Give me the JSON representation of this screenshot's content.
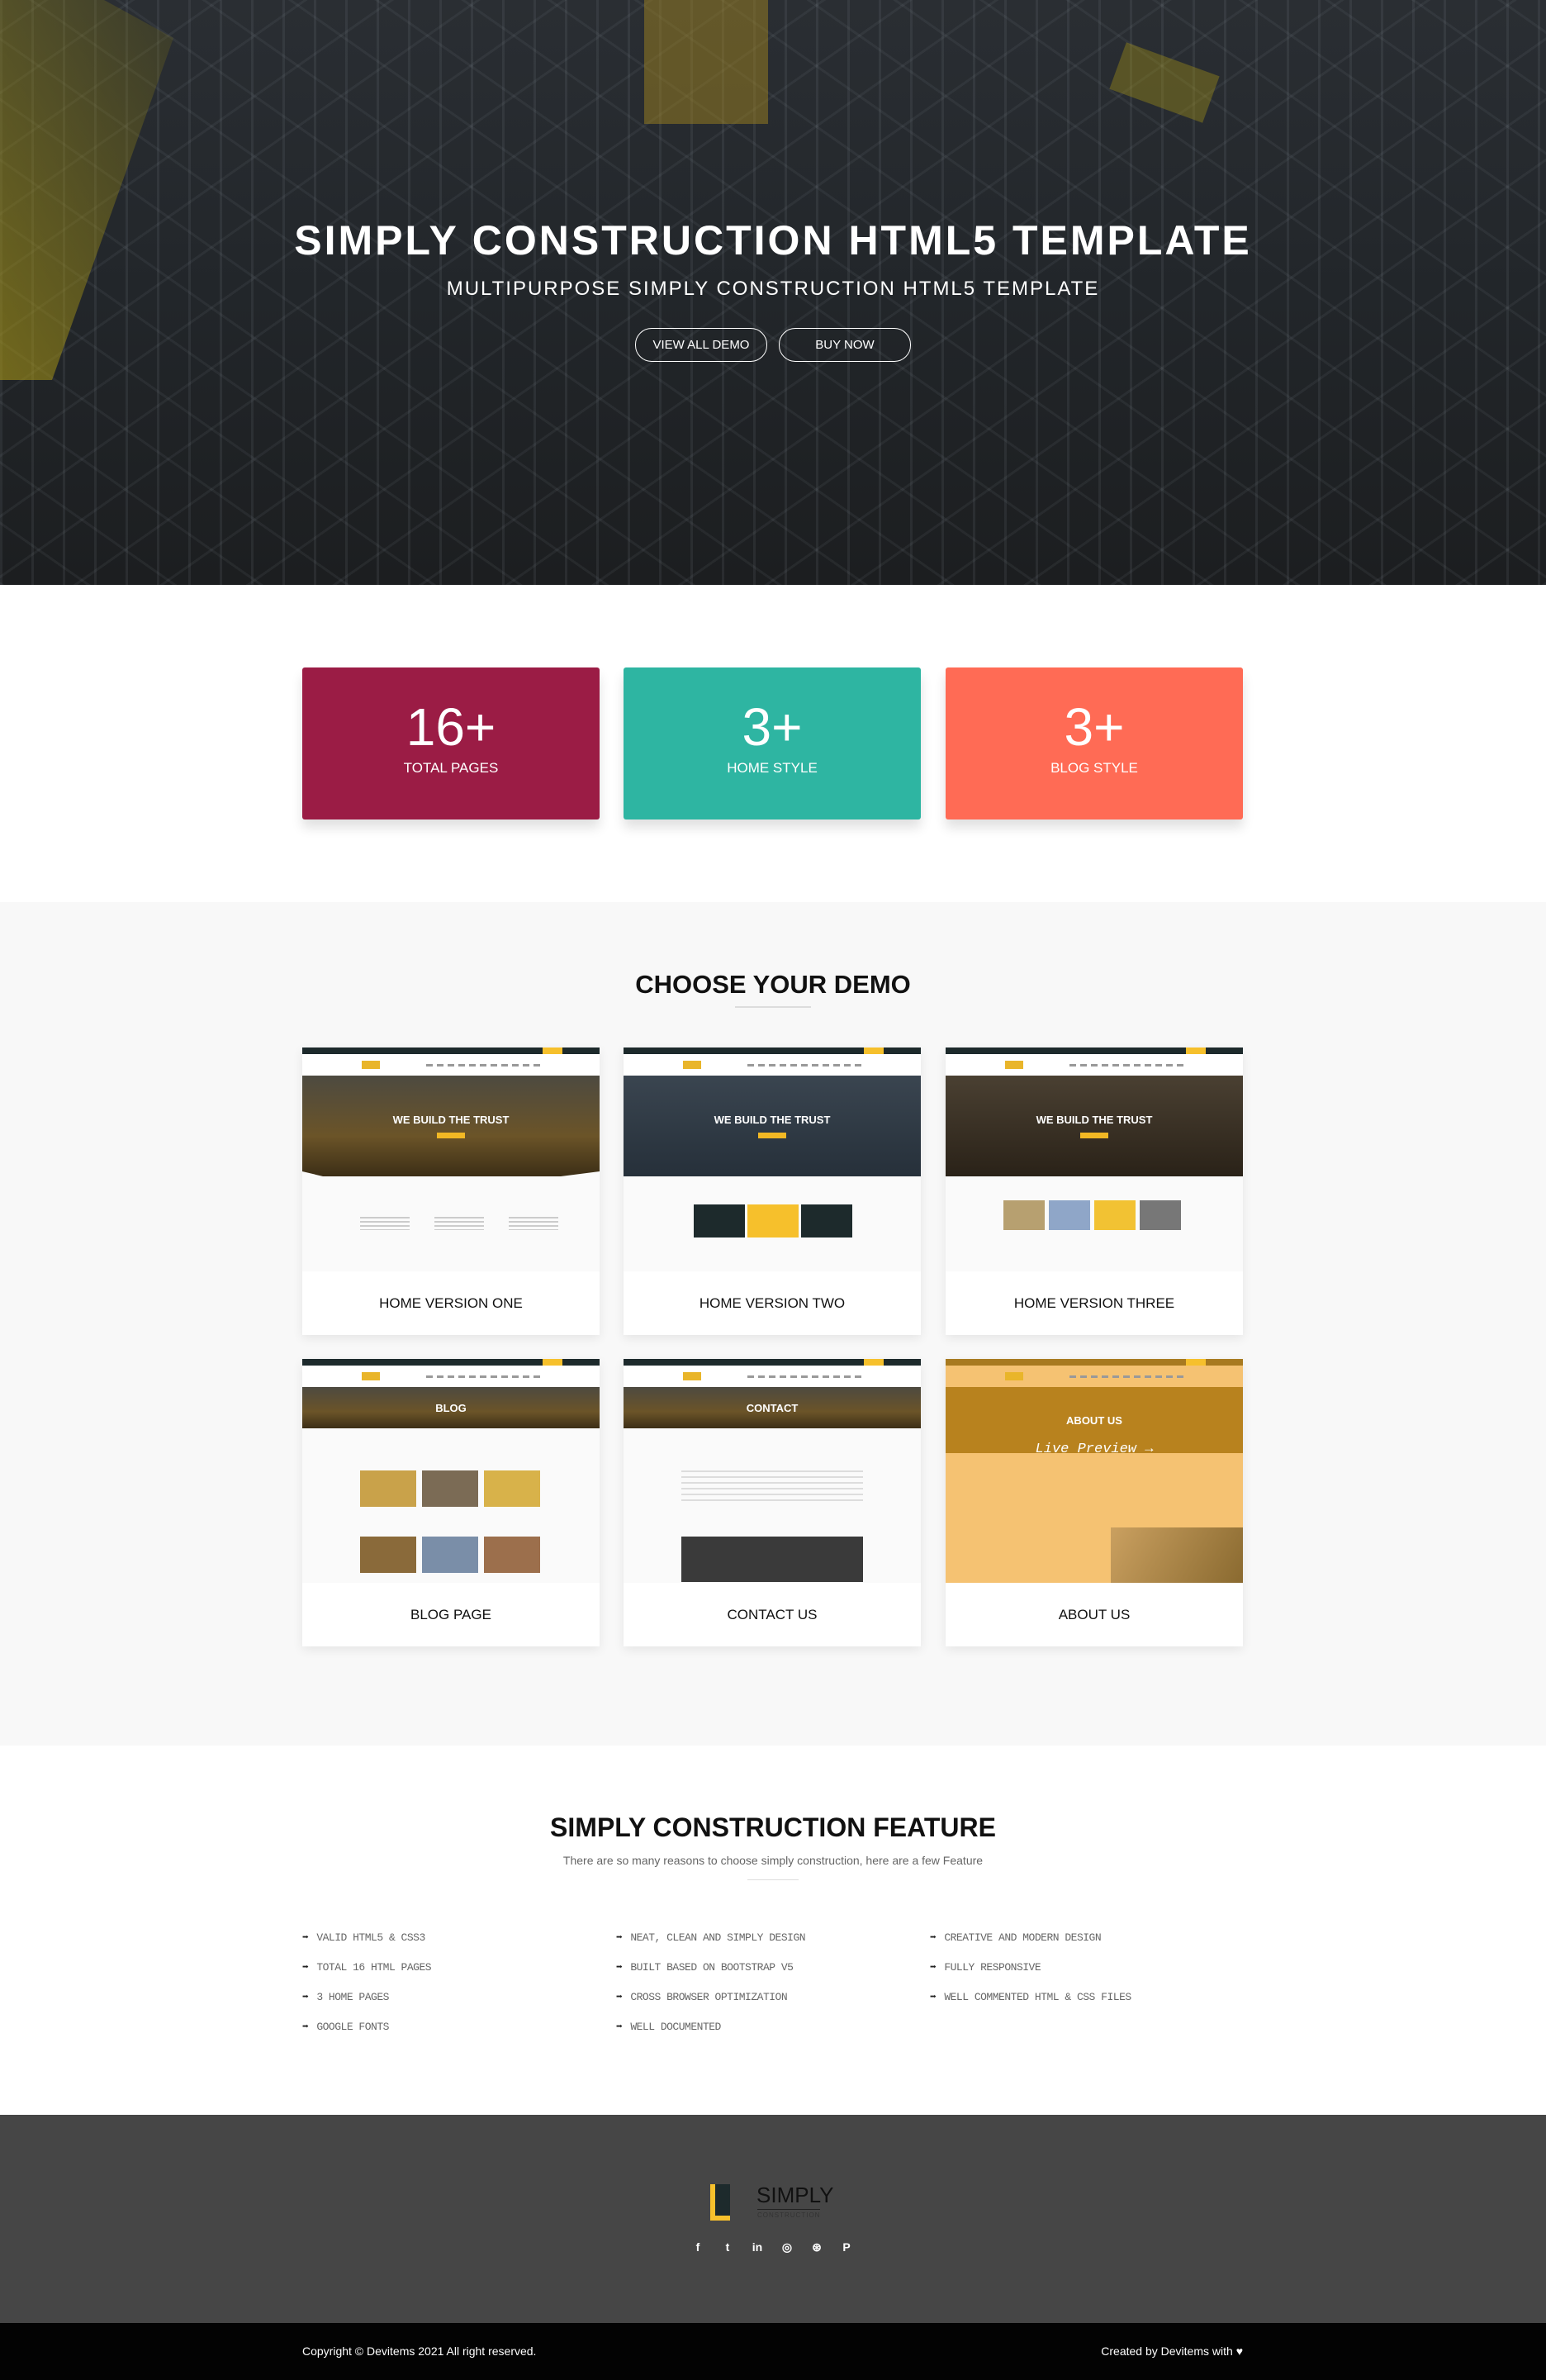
{
  "hero": {
    "title": "SIMPLY CONSTRUCTION HTML5 TEMPLATE",
    "subtitle": "MULTIPURPOSE SIMPLY CONSTRUCTION HTML5 TEMPLATE",
    "buttons": [
      "VIEW ALL DEMO",
      "BUY NOW"
    ]
  },
  "stats": [
    {
      "value": "16+",
      "label": "TOTAL PAGES",
      "color": "#9b1c45"
    },
    {
      "value": "3+",
      "label": "HOME STYLE",
      "color": "#2eb5a2"
    },
    {
      "value": "3+",
      "label": "BLOG STYLE",
      "color": "#ff6b55"
    }
  ],
  "demos": {
    "title": "CHOOSE YOUR DEMO",
    "items": [
      {
        "label": "HOME VERSION ONE",
        "thumb_heading": "WE BUILD THE TRUST"
      },
      {
        "label": "HOME VERSION TWO",
        "thumb_heading": "WE BUILD THE TRUST"
      },
      {
        "label": "HOME VERSION THREE",
        "thumb_heading": "WE BUILD THE TRUST"
      },
      {
        "label": "BLOG PAGE",
        "thumb_heading": "BLOG"
      },
      {
        "label": "CONTACT US",
        "thumb_heading": "CONTACT"
      },
      {
        "label": "ABOUT US",
        "thumb_heading": "ABOUT US",
        "overlay": "Live Preview →"
      }
    ]
  },
  "features": {
    "title": "SIMPLY CONSTRUCTION FEATURE",
    "subtitle": "There are so many reasons to choose simply construction, here are a few Feature",
    "arrow": "➡",
    "columns": [
      [
        "VALID HTML5 & CSS3",
        "TOTAL 16 HTML PAGES",
        "3 HOME PAGES",
        "GOOGLE FONTS"
      ],
      [
        "NEAT, CLEAN AND SIMPLY DESIGN",
        "BUILT BASED ON BOOTSTRAP V5",
        "CROSS BROWSER OPTIMIZATION",
        "WELL DOCUMENTED"
      ],
      [
        "CREATIVE AND MODERN DESIGN",
        "FULLY RESPONSIVE",
        "WELL COMMENTED HTML & CSS FILES"
      ]
    ]
  },
  "footer": {
    "logo_text": "SIMPLY",
    "logo_sub": "CONSTRUCTION",
    "social": [
      {
        "icon": "facebook-icon",
        "glyph": "f"
      },
      {
        "icon": "twitter-icon",
        "glyph": "t"
      },
      {
        "icon": "linkedin-icon",
        "glyph": "in"
      },
      {
        "icon": "instagram-icon",
        "glyph": "◎"
      },
      {
        "icon": "dribbble-icon",
        "glyph": "⊛"
      },
      {
        "icon": "pinterest-icon",
        "glyph": "P"
      }
    ],
    "copyright": "Copyright © Devitems 2021 All right reserved.",
    "credit": "Created by Devitems with",
    "heart": "♥"
  }
}
